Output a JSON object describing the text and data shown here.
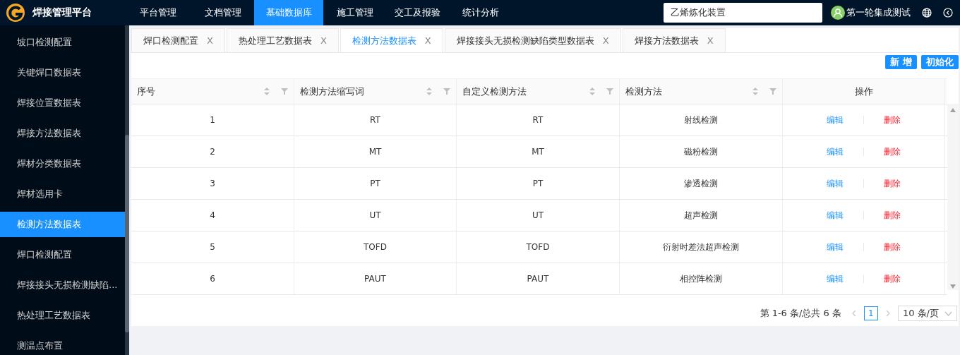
{
  "app": {
    "title": "焊接管理平台"
  },
  "nav": [
    {
      "label": "平台管理",
      "selected": false
    },
    {
      "label": "文档管理",
      "selected": false
    },
    {
      "label": "基础数据库",
      "selected": true
    },
    {
      "label": "施工管理",
      "selected": false
    },
    {
      "label": "交工及报验",
      "selected": false
    },
    {
      "label": "统计分析",
      "selected": false
    }
  ],
  "project_field": {
    "value": "乙烯炼化装置"
  },
  "user": {
    "name": "第一轮集成测试"
  },
  "sidebar": {
    "items": [
      {
        "label": "坡口检测配置",
        "selected": false
      },
      {
        "label": "关键焊口数据表",
        "selected": false
      },
      {
        "label": "焊接位置数据表",
        "selected": false
      },
      {
        "label": "焊接方法数据表",
        "selected": false
      },
      {
        "label": "焊材分类数据表",
        "selected": false
      },
      {
        "label": "焊材选用卡",
        "selected": false
      },
      {
        "label": "检测方法数据表",
        "selected": true
      },
      {
        "label": "焊口检测配置",
        "selected": false
      },
      {
        "label": "焊接接头无损检测缺陷...",
        "selected": false
      },
      {
        "label": "热处理工艺数据表",
        "selected": false
      },
      {
        "label": "测温点布置",
        "selected": false
      }
    ]
  },
  "tabs": [
    {
      "label": "焊口检测配置",
      "selected": false,
      "close": "X"
    },
    {
      "label": "热处理工艺数据表",
      "selected": false,
      "close": "X"
    },
    {
      "label": "检测方法数据表",
      "selected": true,
      "close": "X"
    },
    {
      "label": "焊接接头无损检测缺陷类型数据表",
      "selected": false,
      "close": "X"
    },
    {
      "label": "焊接方法数据表",
      "selected": false,
      "close": "X"
    }
  ],
  "actions": [
    "新 增",
    "初始化"
  ],
  "table": {
    "columns": [
      {
        "label": "序号",
        "sortable": true
      },
      {
        "label": "检测方法缩写词",
        "sortable": true
      },
      {
        "label": "自定义检测方法",
        "sortable": true
      },
      {
        "label": "检测方法",
        "sortable": true
      },
      {
        "label": "操作",
        "sortable": false
      }
    ],
    "rows": [
      {
        "cells": [
          "1",
          "RT",
          "RT",
          "射线检测"
        ],
        "edit": "编辑",
        "delete": "删除"
      },
      {
        "cells": [
          "2",
          "MT",
          "MT",
          "磁粉检测"
        ],
        "edit": "编辑",
        "delete": "删除"
      },
      {
        "cells": [
          "3",
          "PT",
          "PT",
          "渗透检测"
        ],
        "edit": "编辑",
        "delete": "删除"
      },
      {
        "cells": [
          "4",
          "UT",
          "UT",
          "超声检测"
        ],
        "edit": "编辑",
        "delete": "删除"
      },
      {
        "cells": [
          "5",
          "TOFD",
          "TOFD",
          "衍射时差法超声检测"
        ],
        "edit": "编辑",
        "delete": "删除"
      },
      {
        "cells": [
          "6",
          "PAUT",
          "PAUT",
          "相控阵检测"
        ],
        "edit": "编辑",
        "delete": "删除"
      }
    ]
  },
  "pagination": {
    "summary": "第 1-6 条/总共 6 条",
    "pages": [
      {
        "label": "1",
        "selected": true
      }
    ],
    "page_size": "10 条/页"
  }
}
